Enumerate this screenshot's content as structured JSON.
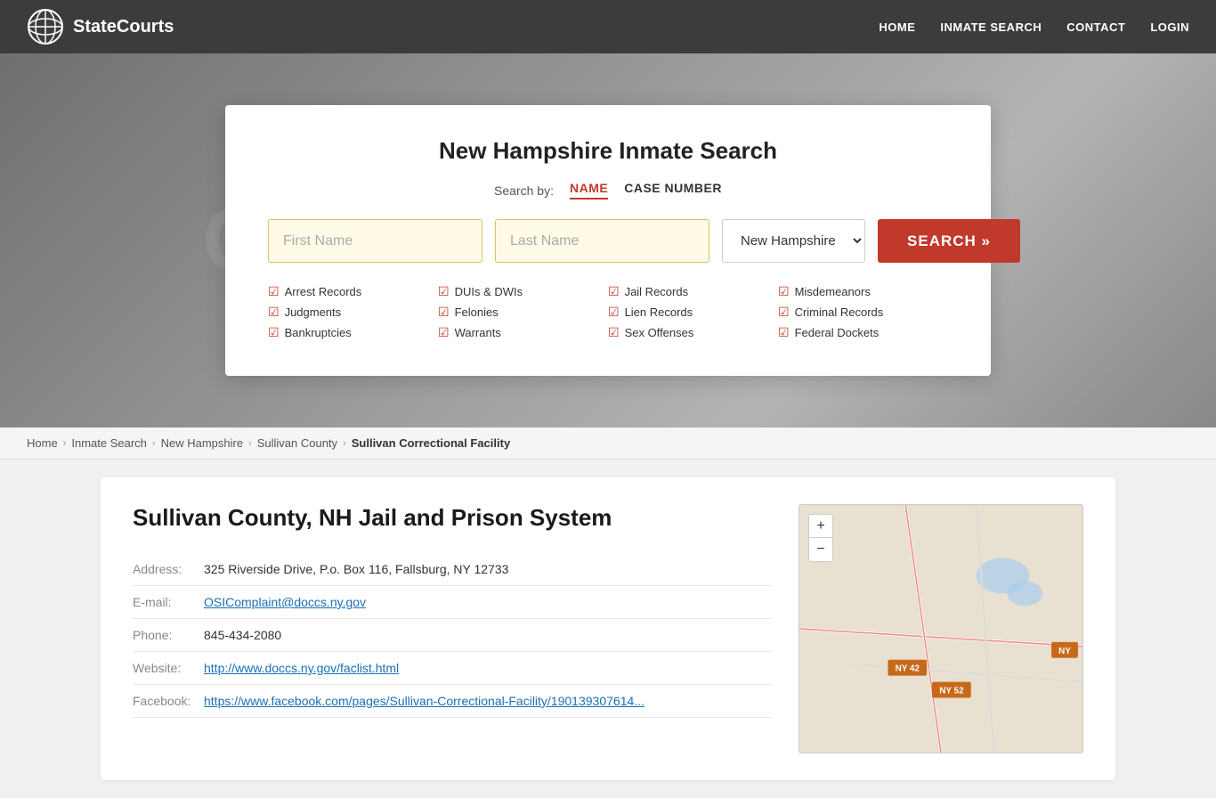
{
  "header": {
    "logo_text": "StateCourts",
    "nav": {
      "home": "HOME",
      "inmate_search": "INMATE SEARCH",
      "contact": "CONTACT",
      "login": "LOGIN"
    }
  },
  "hero_bg_text": "COURTHOUSE",
  "search_card": {
    "title": "New Hampshire Inmate Search",
    "search_by_label": "Search by:",
    "tab_name": "NAME",
    "tab_case": "CASE NUMBER",
    "first_name_placeholder": "First Name",
    "last_name_placeholder": "Last Name",
    "state_value": "New Hampshire",
    "search_button": "SEARCH »",
    "checklist": {
      "col1": [
        {
          "label": "Arrest Records"
        },
        {
          "label": "Judgments"
        },
        {
          "label": "Bankruptcies"
        }
      ],
      "col2": [
        {
          "label": "DUIs & DWIs"
        },
        {
          "label": "Felonies"
        },
        {
          "label": "Warrants"
        }
      ],
      "col3": [
        {
          "label": "Jail Records"
        },
        {
          "label": "Lien Records"
        },
        {
          "label": "Sex Offenses"
        }
      ],
      "col4": [
        {
          "label": "Misdemeanors"
        },
        {
          "label": "Criminal Records"
        },
        {
          "label": "Federal Dockets"
        }
      ]
    }
  },
  "breadcrumb": {
    "home": "Home",
    "inmate_search": "Inmate Search",
    "state": "New Hampshire",
    "county": "Sullivan County",
    "current": "Sullivan Correctional Facility"
  },
  "facility": {
    "title": "Sullivan County, NH Jail and Prison System",
    "address_label": "Address:",
    "address_value": "325 Riverside Drive, P.o. Box 116, Fallsburg, NY 12733",
    "email_label": "E-mail:",
    "email_value": "OSIComplaint@doccs.ny.gov",
    "phone_label": "Phone:",
    "phone_value": "845-434-2080",
    "website_label": "Website:",
    "website_value": "http://www.doccs.ny.gov/faclist.html",
    "facebook_label": "Facebook:",
    "facebook_value": "https://www.facebook.com/pages/Sullivan-Correctional-Facility/190139307614..."
  },
  "map": {
    "zoom_in": "+",
    "zoom_out": "−",
    "road_labels": [
      "NY 42",
      "NY 52",
      "NY"
    ]
  }
}
